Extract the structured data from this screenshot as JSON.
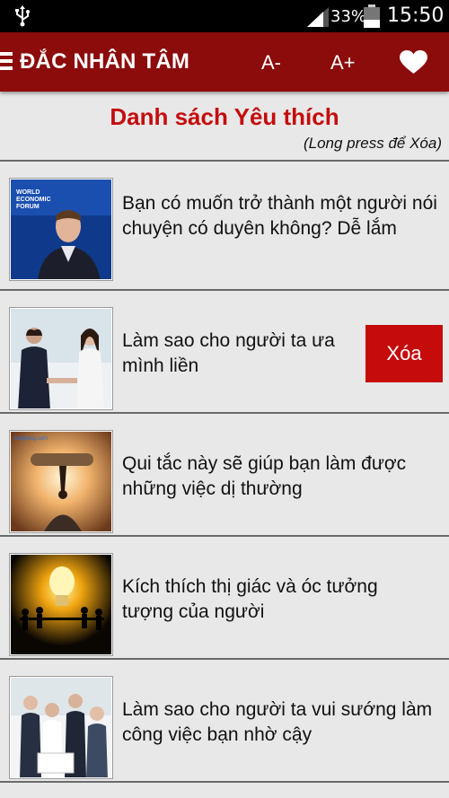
{
  "status_bar": {
    "battery_percent": "33%",
    "time": "15:50",
    "icons": [
      "usb-icon",
      "signal-icon",
      "battery-icon"
    ]
  },
  "app_bar": {
    "title": "ĐẮC NHÂN TÂM",
    "font_decrease_label": "A-",
    "font_increase_label": "A+",
    "icons": [
      "menu-icon",
      "heart-icon"
    ],
    "color": "#8c0b0b"
  },
  "list": {
    "heading": "Danh sách Yêu thích",
    "hint": "(Long press để Xóa)",
    "heading_color": "#c40d0d",
    "items": [
      {
        "title": "Bạn có muốn trở thành một người nói chuyện có duyên không? Dễ lắm",
        "thumbnail": "speaker-photo"
      },
      {
        "title": "Làm sao cho người ta ưa mình liền",
        "thumbnail": "handshake-photo",
        "delete_label": "Xóa"
      },
      {
        "title": "Qui tắc này sẽ giúp bạn làm được những việc dị thường",
        "thumbnail": "ant-lifting-photo"
      },
      {
        "title": "Kích thích thị giác và óc tưởng tượng của người",
        "thumbnail": "lightbulb-people-photo"
      },
      {
        "title": "Làm sao cho người ta vui sướng làm công việc bạn nhờ cậy",
        "thumbnail": "office-team-photo"
      }
    ]
  }
}
